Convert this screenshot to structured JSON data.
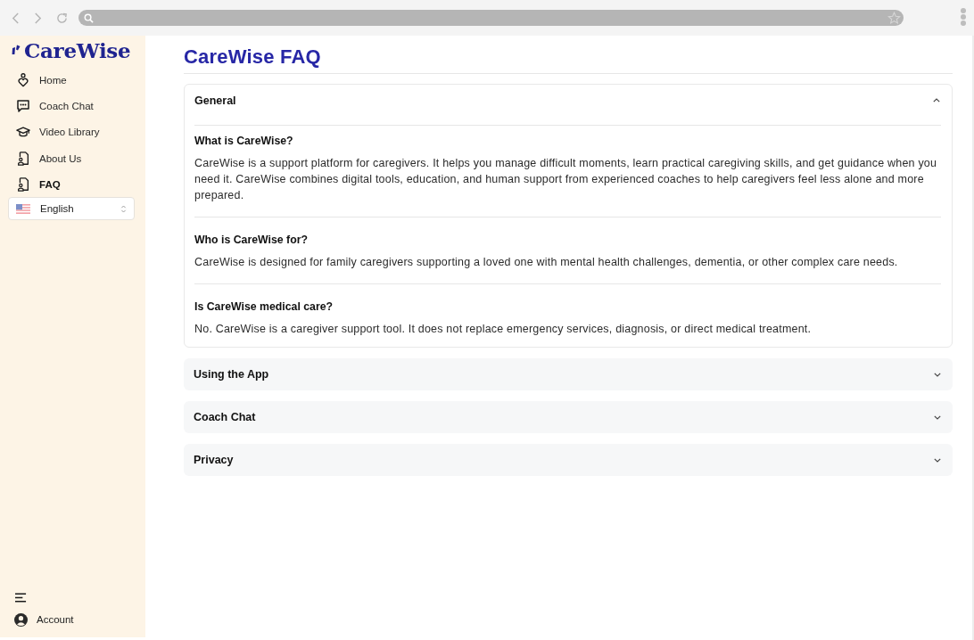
{
  "sidebar": {
    "logo": "CareWise",
    "items": [
      {
        "label": "Home",
        "kind": "home",
        "selected": false
      },
      {
        "label": "Coach Chat",
        "kind": "chat",
        "selected": false
      },
      {
        "label": "Video Library",
        "kind": "learn",
        "selected": false
      },
      {
        "label": "About Us",
        "kind": "profile",
        "selected": false
      },
      {
        "label": "FAQ",
        "kind": "profile",
        "selected": true
      }
    ],
    "language": {
      "value": "English"
    },
    "account": "Account"
  },
  "page": {
    "title": "CareWise FAQ"
  },
  "sections": [
    {
      "title": "General",
      "expanded": true,
      "items": [
        {
          "question": "What is CareWise?",
          "answer": "CareWise is a support platform for caregivers. It helps you manage difficult moments, learn practical caregiving skills, and get guidance when you need it. CareWise combines digital tools, education, and human support from experienced coaches to help caregivers feel less alone and more prepared."
        },
        {
          "question": "Who is CareWise for?",
          "answer": "CareWise is designed for family caregivers supporting a loved one with mental health challenges, dementia, or other complex care needs."
        },
        {
          "question": "Is CareWise medical care?",
          "answer": "No. CareWise is a caregiver support tool. It does not replace emergency services, diagnosis, or direct medical treatment."
        }
      ]
    },
    {
      "title": "Using the App",
      "expanded": false
    },
    {
      "title": "Coach Chat",
      "expanded": false
    },
    {
      "title": "Privacy",
      "expanded": false
    }
  ]
}
